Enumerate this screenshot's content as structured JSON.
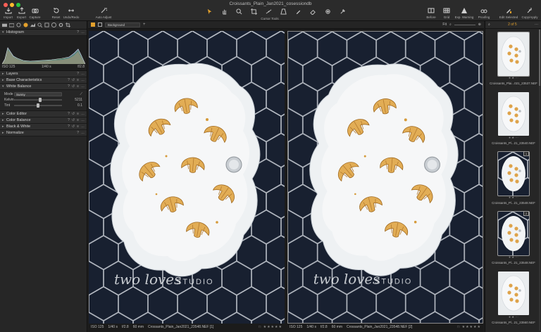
{
  "window": {
    "title": "Croissants_Plain_Jan2021_cosessiondb"
  },
  "toolbar": {
    "left_buttons": [
      {
        "label": "Import",
        "icon": "import-icon"
      },
      {
        "label": "Export",
        "icon": "export-icon"
      },
      {
        "label": "Capture",
        "icon": "camera-icon"
      },
      {
        "label": "Reset",
        "icon": "reset-icon"
      },
      {
        "label": "Undo/Redo",
        "icon": "undo-redo-icon"
      },
      {
        "label": "Auto Adjust",
        "icon": "magic-wand-icon"
      }
    ],
    "cursor_tools_label": "Cursor Tools",
    "right_buttons": [
      {
        "label": "Before",
        "icon": "before-icon"
      },
      {
        "label": "Grid",
        "icon": "grid-icon"
      },
      {
        "label": "Exp. Warning",
        "icon": "warning-icon"
      },
      {
        "label": "Proofing",
        "icon": "glasses-icon"
      },
      {
        "label": "Edit Selected",
        "icon": "edit-selected-icon"
      },
      {
        "label": "Copy/Apply",
        "icon": "copy-apply-icon"
      }
    ]
  },
  "left_panel": {
    "sections": {
      "histogram": "Histogram",
      "layers": "Layers",
      "base_characteristics": "Base Characteristics",
      "white_balance": "White Balance",
      "color_editor": "Color Editor",
      "color_balance": "Color Balance",
      "black_white": "Black & White",
      "normalize": "Normalize"
    },
    "histogram_info": {
      "iso": "ISO 125",
      "shutter": "1/40 s",
      "aperture": "f/2.8"
    },
    "white_balance": {
      "mode_label": "Mode",
      "mode_value": "Sunny",
      "kelvin_label": "Kelvin",
      "kelvin_value": "5211",
      "kelvin_fraction": 0.55,
      "tint_label": "Tint",
      "tint_value": "0.1",
      "tint_fraction": 0.5
    }
  },
  "viewer": {
    "layer_select": "Background",
    "fit_label": "Fit",
    "left_caption": {
      "iso": "ISO 125",
      "shutter": "1/40 s",
      "aperture": "f/2.8",
      "focal": "60 mm",
      "file": "Crossants_Plain_Jan2021_23548.NEF [1]"
    },
    "right_caption": {
      "iso": "ISO 125",
      "shutter": "1/40 s",
      "aperture": "f/2.8",
      "focal": "60 mm",
      "file": "Crossants_Plain_Jan2021_23548.NEF [2]"
    },
    "watermark_script": "two loves",
    "watermark_studio": "STUDIO"
  },
  "browser": {
    "count": "2 of 5",
    "thumbnails": [
      {
        "file": "Croissants_Plai...021_23537.NEF",
        "badge": ""
      },
      {
        "file": "Croissants_Pl...21_23540.NEF",
        "badge": ""
      },
      {
        "file": "Croissants_Pl...21_23548.NEF",
        "badge": "1"
      },
      {
        "file": "Croissants_Pl...21_23548.NEF",
        "badge": "2"
      },
      {
        "file": "Croissants_Pl...21_23560.NEF",
        "badge": ""
      }
    ]
  },
  "colors": {
    "accent": "#e3a02c",
    "background": "#1e1e1e",
    "tile": "#1a2233",
    "grout": "#d8dde4"
  }
}
